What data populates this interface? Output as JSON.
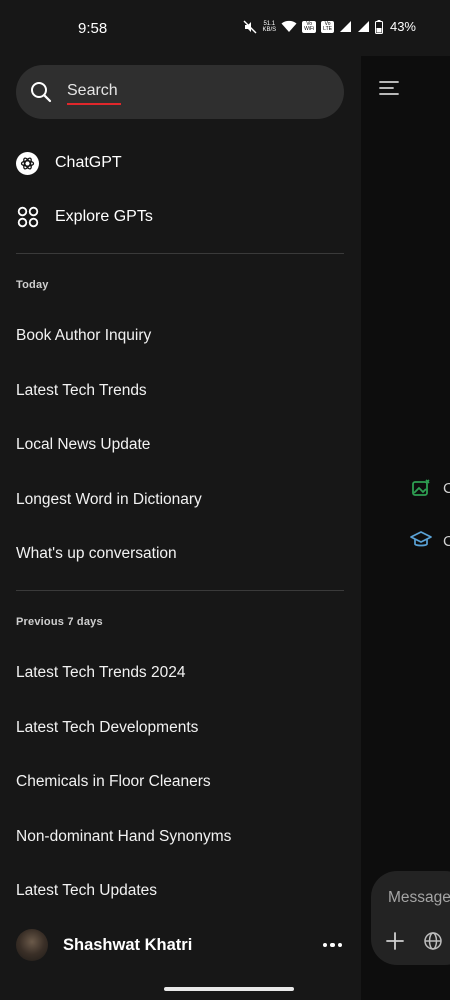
{
  "status_bar": {
    "time": "9:58",
    "net_speed_value": "51.1",
    "net_speed_unit": "KB/S",
    "wifi_tag_top": "Vo",
    "wifi_tag_bottom": "WiFi",
    "lte_tag_top": "Vo",
    "lte_tag_bottom": "LTE",
    "battery": "43%"
  },
  "drawer": {
    "search": {
      "label": "Search",
      "icon": "search-icon"
    },
    "nav": [
      {
        "label": "ChatGPT",
        "icon": "chatgpt-logo-icon"
      },
      {
        "label": "Explore GPTs",
        "icon": "grid-icon"
      }
    ],
    "sections": [
      {
        "title": "Today",
        "items": [
          "Book Author Inquiry",
          "Latest Tech Trends",
          "Local News Update",
          "Longest Word in Dictionary",
          "What's up conversation"
        ]
      },
      {
        "title": "Previous 7 days",
        "items": [
          "Latest Tech Trends 2024",
          "Latest Tech Developments",
          "Chemicals in Floor Cleaners",
          "Non-dominant Hand Synonyms",
          "Latest Tech Updates"
        ]
      }
    ],
    "user": {
      "name": "Shashwat Khatri"
    }
  },
  "main": {
    "suggestion_1_letter": "C",
    "suggestion_2_letter": "C",
    "composer_placeholder": "Message"
  },
  "colors": {
    "drawer_bg": "#171717",
    "main_bg": "#0d0d0d",
    "search_bg": "#2f2f2f",
    "search_underline": "#e0272b",
    "image_icon": "#2e9e52",
    "grad_cap_icon": "#5aa2d6"
  }
}
